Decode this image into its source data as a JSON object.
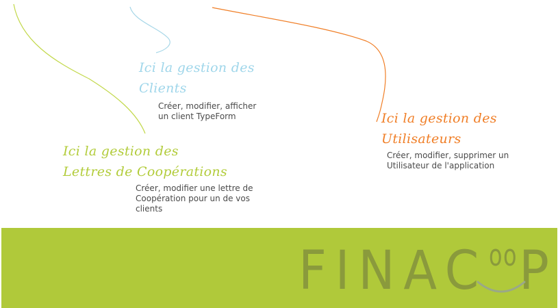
{
  "callouts": {
    "clients": {
      "title_line1": "Ici la gestion des",
      "title_line2": "Clients",
      "description": "Créer, modifier, afficher un client TypeForm",
      "color": "#9fd6ea"
    },
    "utilisateurs": {
      "title_line1": "Ici la gestion des",
      "title_line2": "Utilisateurs",
      "description": "Créer, modifier, supprimer un Utilisateur de l'application",
      "color": "#f07e26"
    },
    "lettres": {
      "title_line1": "Ici la gestion des",
      "title_line2": "Lettres de Coopérations",
      "description": "Créer, modifier une lettre de Coopération pour un de vos clients",
      "color": "#b2cc3a"
    }
  },
  "footer": {
    "background_color": "#b0c93a",
    "logo": {
      "text_main": "FINAC",
      "text_superscript": "oo",
      "text_end": "P",
      "color": "#8a9a3c",
      "smile_color": "#9aa888"
    }
  }
}
